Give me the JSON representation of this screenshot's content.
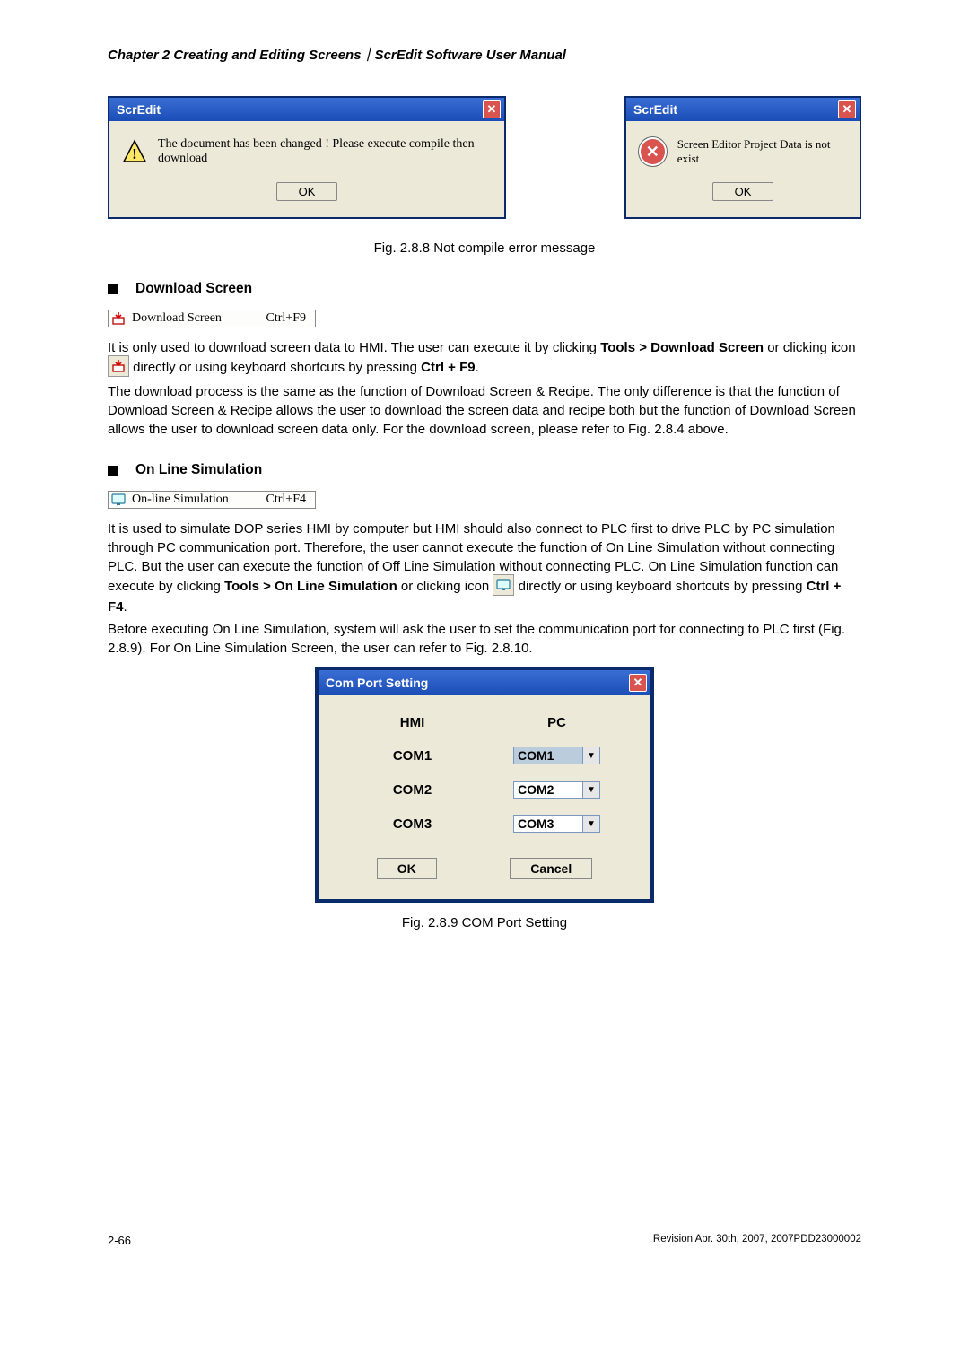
{
  "header": "Chapter 2  Creating and Editing Screens｜ScrEdit Software User Manual",
  "dialog1": {
    "title": "ScrEdit",
    "msg": "The document has been changed ! Please execute compile then download",
    "ok": "OK"
  },
  "dialog2": {
    "title": "ScrEdit",
    "msg": "Screen Editor Project Data is not exist",
    "ok": "OK"
  },
  "fig288": "Fig. 2.8.8 Not compile error message",
  "sect_download": "Download Screen",
  "menu_download": {
    "label": "Download Screen",
    "shortcut": "Ctrl+F9"
  },
  "p1a": "It is only used to download screen data to HMI. The user can execute it by clicking ",
  "p1b": "Tools > Download Screen",
  "p1c": " or clicking icon ",
  "p1d": " directly or using keyboard shortcuts by pressing ",
  "p1e": "Ctrl + F9",
  "p1f": ".",
  "p2": "The download process is the same as the function of Download Screen & Recipe. The only difference is that the function of Download Screen & Recipe allows the user to download the screen data and recipe both but the function of Download Screen allows the user to download screen data only. For the download screen, please refer to Fig. 2.8.4 above.",
  "sect_online": "On Line Simulation",
  "menu_online": {
    "label": "On-line Simulation",
    "shortcut": "Ctrl+F4"
  },
  "p3": "It is used to simulate DOP series HMI by computer but HMI should also connect to PLC first to drive PLC by PC simulation through PC communication port. Therefore, the user cannot execute the function of On Line Simulation without connecting PLC. But the user can execute the function of Off Line Simulation without connecting PLC. On Line Simulation function can execute by clicking ",
  "p3b": "Tools > On Line Simulation",
  "p3c": " or clicking icon ",
  "p3d": " directly or using keyboard shortcuts by pressing ",
  "p3e": "Ctrl + F4",
  "p3f": ".",
  "p4": "Before executing On Line Simulation, system will ask the user to set the communication port for connecting to PLC first (Fig. 2.8.9). For On Line Simulation Screen, the user can refer to Fig. 2.8.10.",
  "comdlg": {
    "title": "Com Port Setting",
    "head_hmi": "HMI",
    "head_pc": "PC",
    "rows": [
      "COM1",
      "COM2",
      "COM3"
    ],
    "pc": [
      "COM1",
      "COM2",
      "COM3"
    ],
    "ok": "OK",
    "cancel": "Cancel"
  },
  "fig289": "Fig. 2.8.9 COM Port Setting",
  "pageNo": "2-66",
  "revision": "Revision Apr. 30th, 2007, 2007PDD23000002"
}
